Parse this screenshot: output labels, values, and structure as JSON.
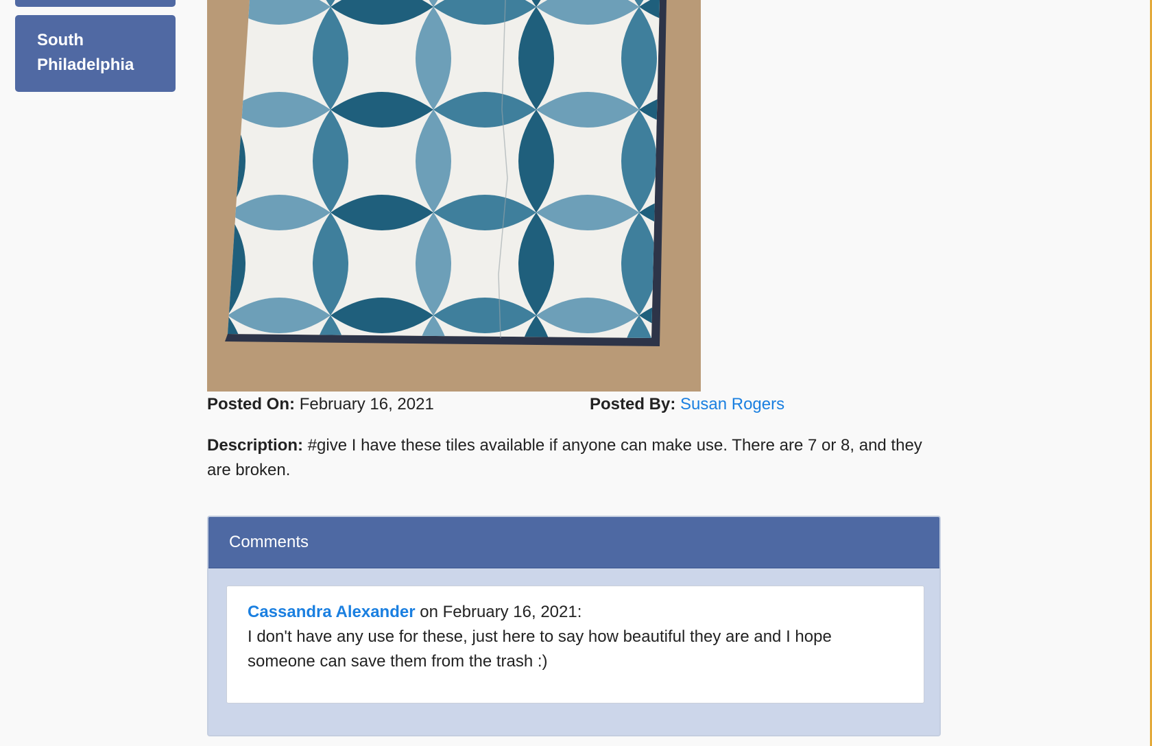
{
  "sidebar": {
    "items": [
      {
        "label": ""
      },
      {
        "label": "South Philadelphia"
      }
    ]
  },
  "post": {
    "posted_on_label": "Posted On:",
    "posted_on": "February 16, 2021",
    "posted_by_label": "Posted By:",
    "posted_by": "Susan Rogers",
    "description_label": "Description:",
    "description": "#give I have these tiles available if anyone can make use. There are 7 or 8, and they are broken."
  },
  "comments": {
    "title": "Comments",
    "items": [
      {
        "author": "Cassandra Alexander",
        "date_text": "on February 16, 2021:",
        "text": "I don't have any use for these, just here to say how beautiful they are and I hope someone can save them from the trash :)"
      }
    ]
  },
  "colors": {
    "sidebar_button": "#5069a3",
    "panel_header": "#4e69a3",
    "panel_body": "#ccd6ea",
    "link": "#1a7fe0",
    "tile_dark": "#1f5f7c",
    "tile_mid": "#3f7f9c",
    "tile_light": "#6d9fb8"
  }
}
